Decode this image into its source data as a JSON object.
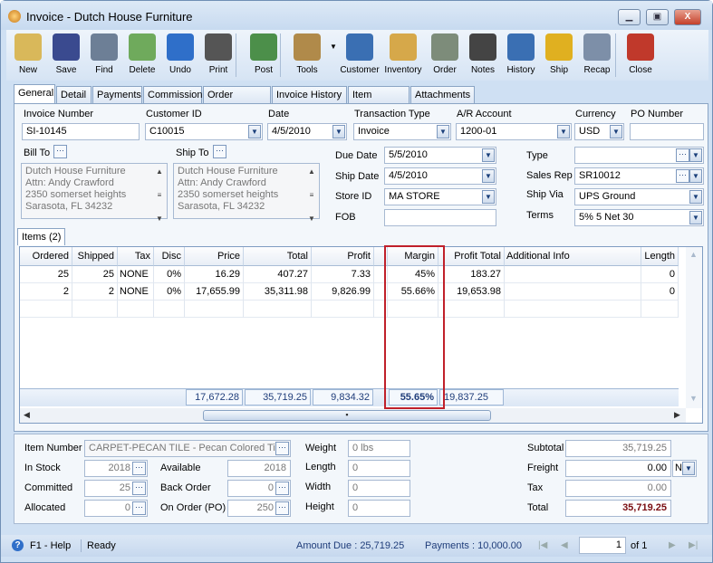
{
  "window": {
    "title": "Invoice - Dutch House Furniture"
  },
  "toolbar": {
    "buttons": [
      {
        "label": "New",
        "icon": "new-document-icon"
      },
      {
        "label": "Save",
        "icon": "floppy-disk-icon"
      },
      {
        "label": "Find",
        "icon": "binoculars-icon"
      },
      {
        "label": "Delete",
        "icon": "recycle-bin-icon"
      },
      {
        "label": "Undo",
        "icon": "undo-arrow-icon"
      },
      {
        "label": "Print",
        "icon": "printer-icon"
      },
      {
        "label": "Post",
        "icon": "post-checkmark-icon"
      },
      {
        "label": "Tools",
        "icon": "tools-icon"
      },
      {
        "label": "Customer",
        "icon": "customer-person-icon"
      },
      {
        "label": "Inventory",
        "icon": "boxes-icon"
      },
      {
        "label": "Order",
        "icon": "order-device-icon"
      },
      {
        "label": "Notes",
        "icon": "notepad-icon"
      },
      {
        "label": "History",
        "icon": "history-hourglass-icon"
      },
      {
        "label": "Ship",
        "icon": "forklift-icon"
      },
      {
        "label": "Recap",
        "icon": "recap-document-icon"
      },
      {
        "label": "Close",
        "icon": "close-window-icon"
      }
    ]
  },
  "tabs": [
    "General",
    "Detail",
    "Payments",
    "Commission",
    "Order History",
    "Invoice History",
    "Item History",
    "Attachments"
  ],
  "header": {
    "invoice_number": {
      "label": "Invoice Number",
      "value": "SI-10145"
    },
    "customer_id": {
      "label": "Customer ID",
      "value": "C10015"
    },
    "date": {
      "label": "Date",
      "value": "4/5/2010"
    },
    "transaction_type": {
      "label": "Transaction Type",
      "value": "Invoice"
    },
    "ar_account": {
      "label": "A/R Account",
      "value": "1200-01"
    },
    "currency": {
      "label": "Currency",
      "value": "USD"
    },
    "po_number": {
      "label": "PO Number",
      "value": ""
    },
    "bill_to": {
      "label": "Bill To",
      "lines": [
        "Dutch House Furniture",
        "Attn: Andy Crawford",
        "2350 somerset heights",
        "Sarasota, FL 34232"
      ]
    },
    "ship_to": {
      "label": "Ship To",
      "lines": [
        "Dutch House Furniture",
        "Attn: Andy Crawford",
        "2350 somerset heights",
        "Sarasota, FL 34232"
      ]
    },
    "due_date": {
      "label": "Due Date",
      "value": "5/5/2010"
    },
    "ship_date": {
      "label": "Ship Date",
      "value": "4/5/2010"
    },
    "store_id": {
      "label": "Store ID",
      "value": "MA STORE"
    },
    "fob": {
      "label": "FOB",
      "value": ""
    },
    "type": {
      "label": "Type",
      "value": ""
    },
    "sales_rep": {
      "label": "Sales Rep",
      "value": "SR10012"
    },
    "ship_via": {
      "label": "Ship Via",
      "value": "UPS Ground"
    },
    "terms": {
      "label": "Terms",
      "value": "5% 5 Net 30"
    }
  },
  "items": {
    "tab_label": "Items (2)",
    "columns": [
      "Ordered",
      "Shipped",
      "Tax",
      "Disc",
      "Price",
      "Total",
      "Profit",
      "",
      "Margin",
      "Profit Total",
      "Additional Info",
      "Length"
    ],
    "rows": [
      [
        "25",
        "25",
        "NONE",
        "0%",
        "16.29",
        "407.27",
        "7.33",
        "",
        "45%",
        "183.27",
        "",
        "0"
      ],
      [
        "2",
        "2",
        "NONE",
        "0%",
        "17,655.99",
        "35,311.98",
        "9,826.99",
        "",
        "55.66%",
        "19,653.98",
        "",
        "0"
      ]
    ],
    "totals": {
      "price": "17,672.28",
      "total": "35,719.25",
      "profit": "9,834.32",
      "margin": "55.65%",
      "profit_total": "19,837.25"
    },
    "highlight_color": "#c0202a"
  },
  "item_detail": {
    "item_number": {
      "label": "Item Number",
      "value": "CARPET-PECAN TILE - Pecan Colored Tiles"
    },
    "in_stock": {
      "label": "In Stock",
      "value": "2018"
    },
    "committed": {
      "label": "Committed",
      "value": "25"
    },
    "allocated": {
      "label": "Allocated",
      "value": "0"
    },
    "available": {
      "label": "Available",
      "value": "2018"
    },
    "back_order": {
      "label": "Back Order",
      "value": "0"
    },
    "on_order": {
      "label": "On Order (PO)",
      "value": "250"
    },
    "weight": {
      "label": "Weight",
      "value": "0 lbs"
    },
    "length": {
      "label": "Length",
      "value": "0"
    },
    "width": {
      "label": "Width",
      "value": "0"
    },
    "height": {
      "label": "Height",
      "value": "0"
    }
  },
  "summary": {
    "subtotal": {
      "label": "Subtotal",
      "value": "35,719.25"
    },
    "freight": {
      "label": "Freight",
      "value": "0.00",
      "option": "N"
    },
    "tax": {
      "label": "Tax",
      "value": "0.00"
    },
    "total": {
      "label": "Total",
      "value": "35,719.25",
      "color": "#7a0e12"
    }
  },
  "status": {
    "help": "F1 - Help",
    "state": "Ready",
    "amount_due": "Amount Due : 25,719.25",
    "payments": "Payments : 10,000.00",
    "page": "1",
    "of": "of 1"
  }
}
